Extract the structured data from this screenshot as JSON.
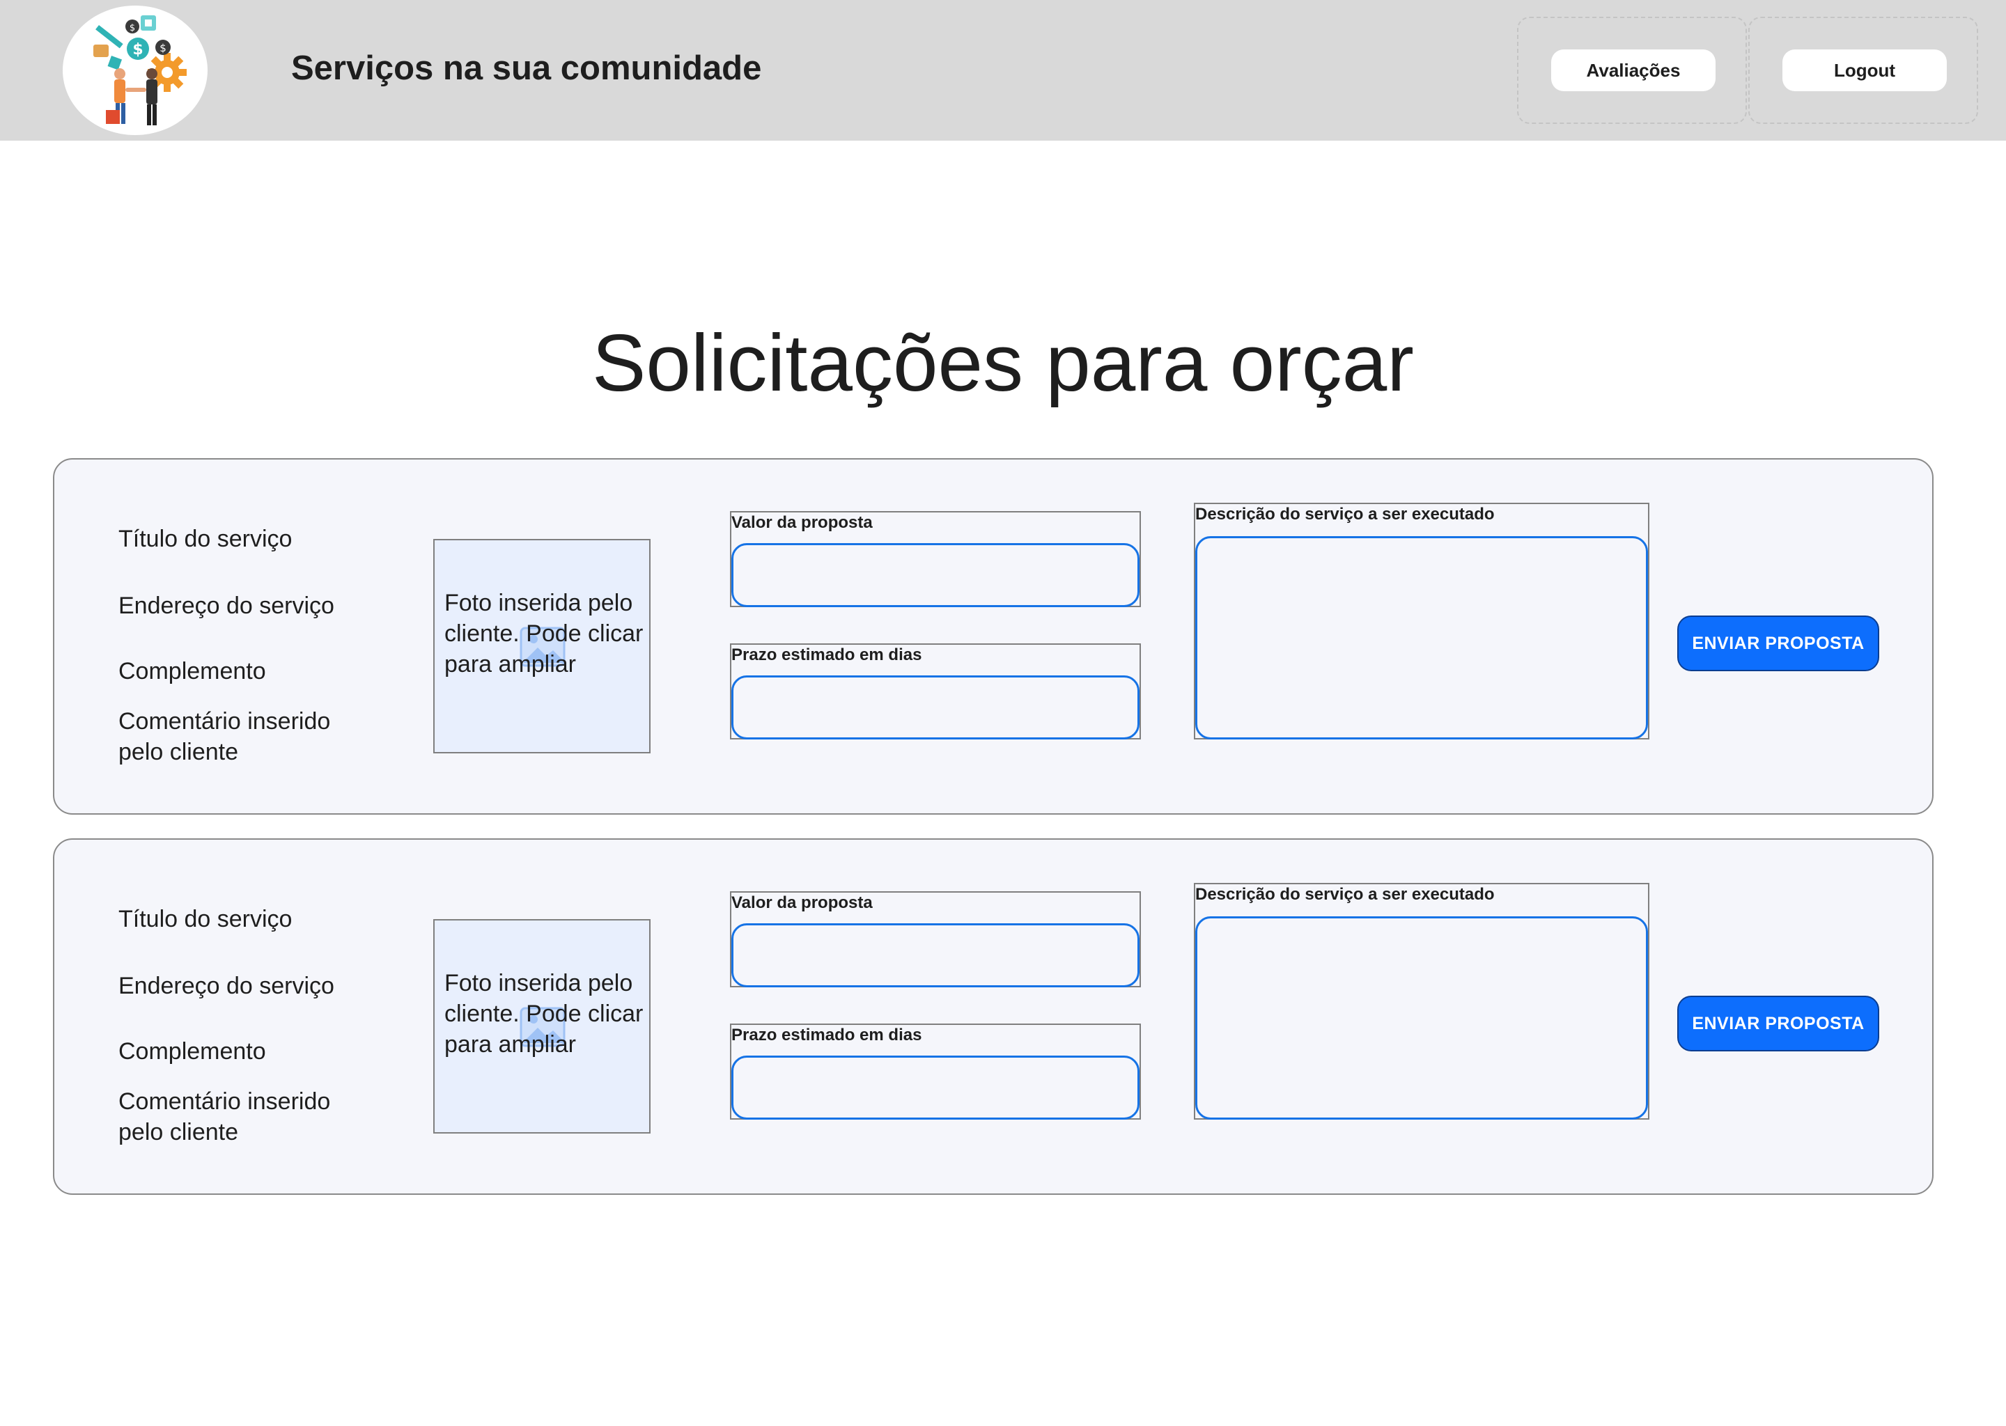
{
  "header": {
    "app_title": "Serviços na sua comunidade",
    "logo_icon": "handshake-services-logo",
    "nav": {
      "reviews_label": "Avaliações",
      "logout_label": "Logout"
    }
  },
  "main": {
    "page_title": "Solicitações para orçar",
    "cards": [
      {
        "service_title": "Título do serviço",
        "service_address": "Endereço do serviço",
        "complement": "Complemento",
        "client_comment": "Comentário inserido pelo cliente",
        "photo_text": "Foto inserida pelo cliente. Pode clicar para ampliar",
        "photo_icon": "image-placeholder-icon",
        "proposal_value_label": "Valor da proposta",
        "proposal_value": "",
        "deadline_label": "Prazo estimado em dias",
        "deadline_value": "",
        "description_label": "Descrição do serviço a ser executado",
        "description_value": "",
        "send_label": "ENVIAR PROPOSTA"
      },
      {
        "service_title": "Título do serviço",
        "service_address": "Endereço do serviço",
        "complement": "Complemento",
        "client_comment": "Comentário inserido pelo cliente",
        "photo_text": "Foto inserida pelo cliente. Pode clicar para ampliar",
        "photo_icon": "image-placeholder-icon",
        "proposal_value_label": "Valor da proposta",
        "proposal_value": "",
        "deadline_label": "Prazo estimado em dias",
        "deadline_value": "",
        "description_label": "Descrição do serviço a ser executado",
        "description_value": "",
        "send_label": "ENVIAR PROPOSTA"
      }
    ]
  },
  "colors": {
    "header_bg": "#d9d9d9",
    "card_bg": "#f5f6fb",
    "photo_bg": "#e8effd",
    "input_border": "#1673e6",
    "primary_button": "#0d6efd",
    "text": "#1e1e1e"
  }
}
